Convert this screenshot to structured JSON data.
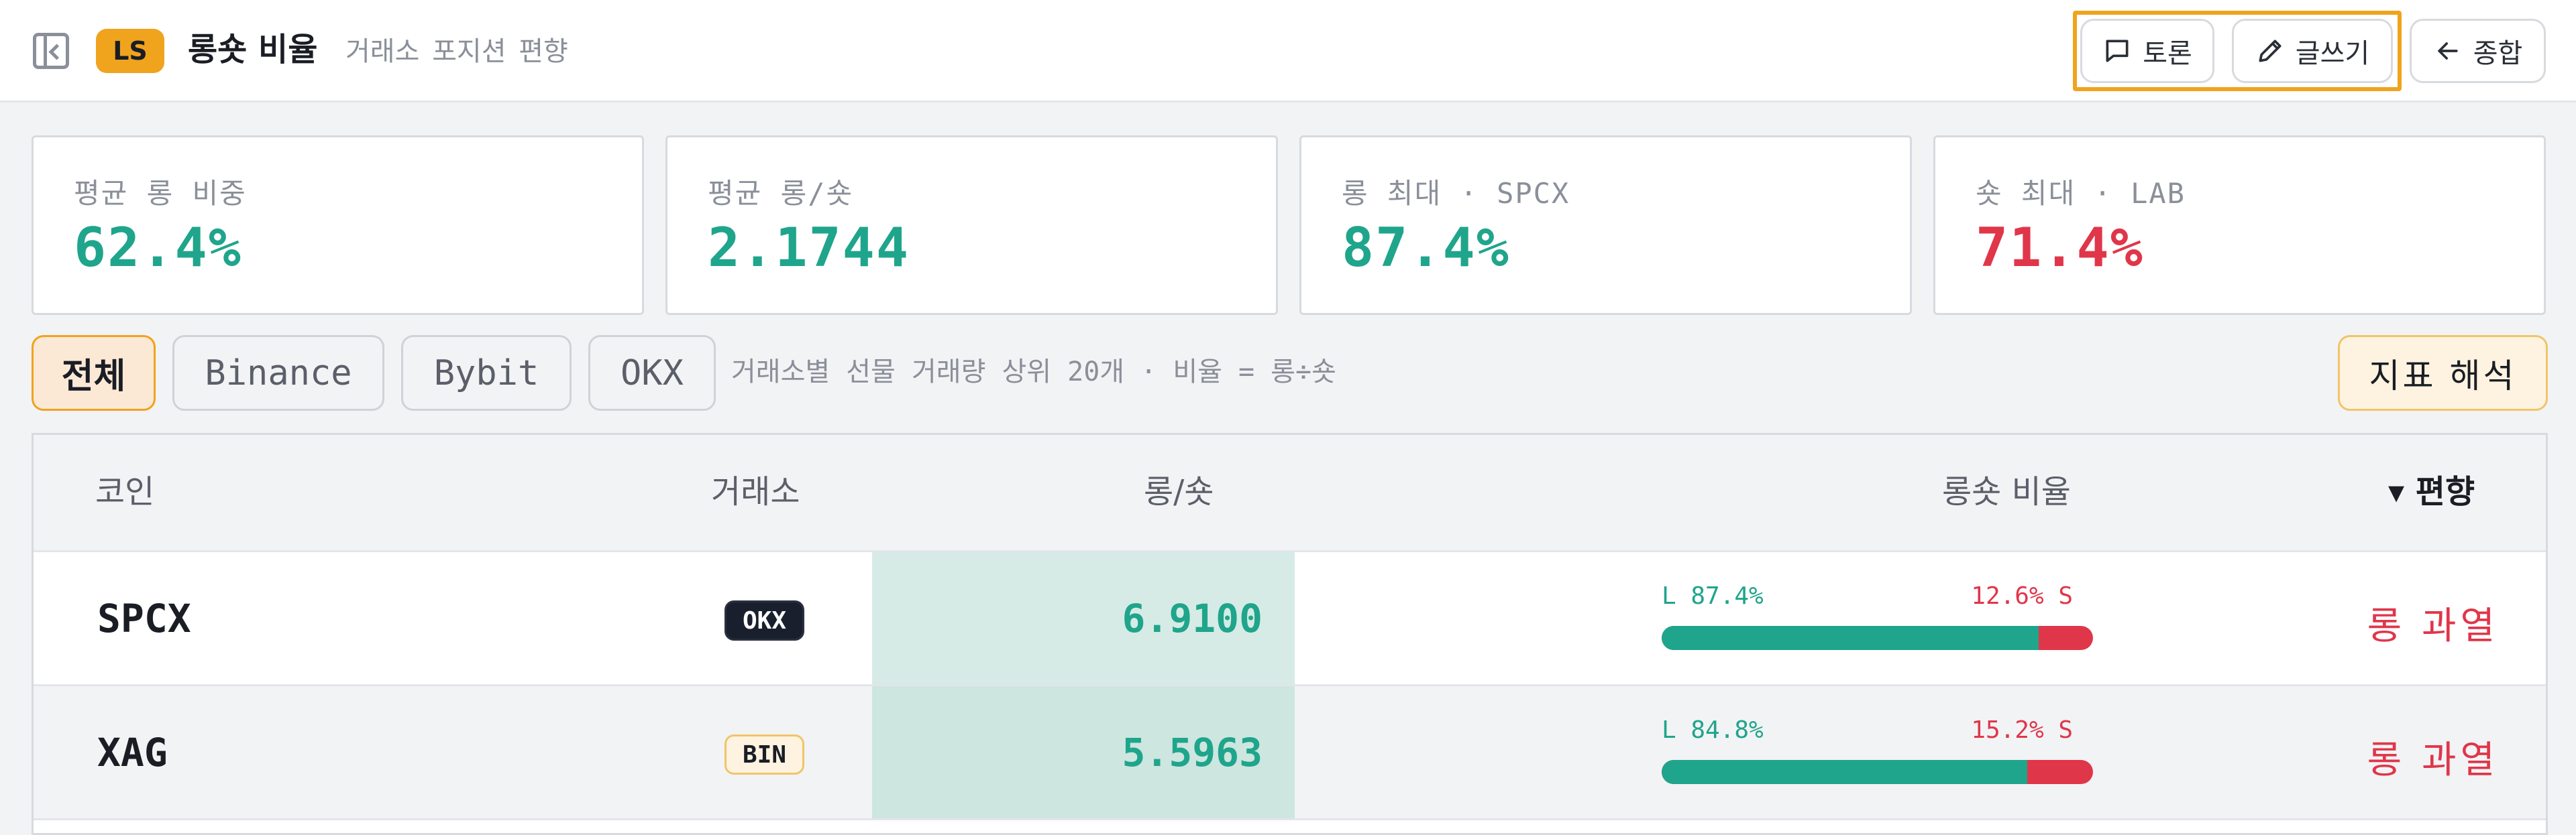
{
  "header": {
    "badge": "LS",
    "title": "롱숏 비율",
    "subtitle": "거래소 포지션 편향",
    "discuss_label": "토론",
    "write_label": "글쓰기",
    "overview_label": "종합"
  },
  "stats": [
    {
      "label": "평균 롱 비중",
      "value": "62.4%",
      "color": "#1fa58b"
    },
    {
      "label": "평균 롱/숏",
      "value": "2.1744",
      "color": "#1fa58b"
    },
    {
      "label": "롱 최대 · SPCX",
      "value": "87.4%",
      "color": "#1fa58b"
    },
    {
      "label": "숏 최대 · LAB",
      "value": "71.4%",
      "color": "#e0364a"
    }
  ],
  "tabs": {
    "all": "전체",
    "binance": "Binance",
    "bybit": "Bybit",
    "okx": "OKX",
    "note": "거래소별 선물 거래량 상위 20개 · 비율 = 롱÷숏",
    "interpret": "지표 해석"
  },
  "table": {
    "headers": {
      "coin": "코인",
      "exchange": "거래소",
      "ratio": "롱/숏",
      "ls_ratio": "롱숏 비율",
      "bias": "▾ 편향"
    },
    "rows": [
      {
        "coin": "SPCX",
        "exchange": "OKX",
        "ratio": "6.9100",
        "long_label": "L 87.4%",
        "short_label": "12.6% S",
        "long_pct": 87.4,
        "bias": "롱 과열"
      },
      {
        "coin": "XAG",
        "exchange": "BIN",
        "ratio": "5.5963",
        "long_label": "L 84.8%",
        "short_label": "15.2% S",
        "long_pct": 84.8,
        "bias": "롱 과열"
      }
    ]
  },
  "colors": {
    "long": "#1fa58b",
    "short": "#e0364a",
    "accent": "#f0a31d",
    "ratio_bg_row1": "#d6ebe5",
    "ratio_bg_row2": "#cde6df"
  }
}
